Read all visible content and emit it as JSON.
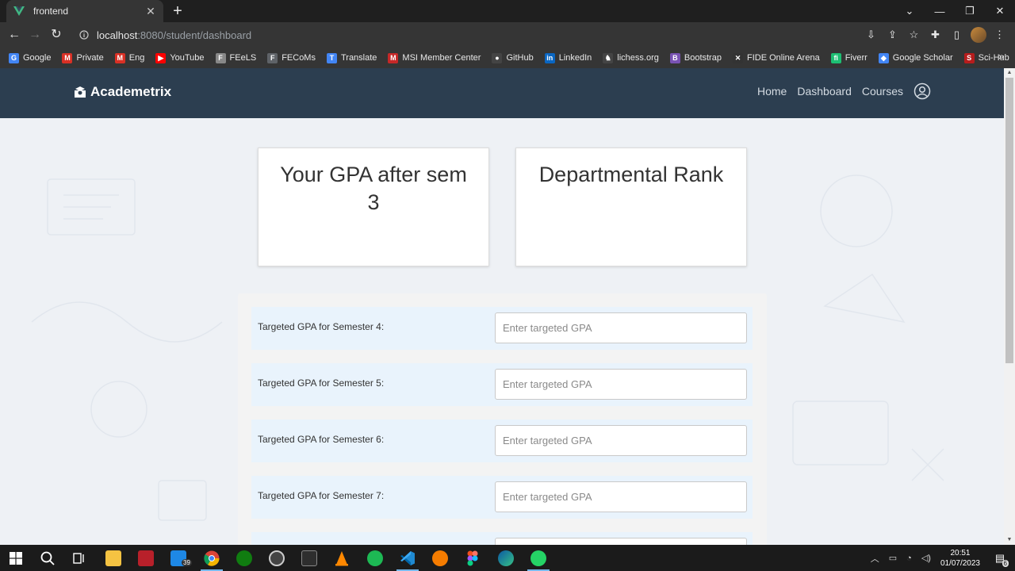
{
  "browser": {
    "tab_title": "frontend",
    "url_host": "localhost",
    "url_rest": ":8080/student/dashboard",
    "bookmarks": [
      {
        "label": "Google",
        "color": "#4285f4",
        "glyph": "G"
      },
      {
        "label": "Private",
        "color": "#d93025",
        "glyph": "M"
      },
      {
        "label": "Eng",
        "color": "#d93025",
        "glyph": "M"
      },
      {
        "label": "YouTube",
        "color": "#ff0000",
        "glyph": "▶"
      },
      {
        "label": "FEeLS",
        "color": "#888888",
        "glyph": "F"
      },
      {
        "label": "FECoMs",
        "color": "#5f6368",
        "glyph": "F"
      },
      {
        "label": "Translate",
        "color": "#4285f4",
        "glyph": "T"
      },
      {
        "label": "MSI Member Center",
        "color": "#c62828",
        "glyph": "M"
      },
      {
        "label": "GitHub",
        "color": "#444444",
        "glyph": "●"
      },
      {
        "label": "LinkedIn",
        "color": "#0a66c2",
        "glyph": "in"
      },
      {
        "label": "lichess.org",
        "color": "#444444",
        "glyph": "♞"
      },
      {
        "label": "Bootstrap",
        "color": "#7952b3",
        "glyph": "B"
      },
      {
        "label": "FIDE Online Arena",
        "color": "#333333",
        "glyph": "✕"
      },
      {
        "label": "Fiverr",
        "color": "#1dbf73",
        "glyph": "fi"
      },
      {
        "label": "Google Scholar",
        "color": "#4285f4",
        "glyph": "◆"
      },
      {
        "label": "Sci-Hub",
        "color": "#b71c1c",
        "glyph": "S"
      }
    ],
    "bookmarks_more": "»"
  },
  "app": {
    "brand": "Academetrix",
    "nav": {
      "home": "Home",
      "dashboard": "Dashboard",
      "courses": "Courses"
    }
  },
  "cards": {
    "gpa_title": "Your GPA after sem 3",
    "rank_title": "Departmental Rank"
  },
  "form": {
    "rows": [
      {
        "label": "Targeted GPA for Semester 4:",
        "placeholder": "Enter targeted GPA"
      },
      {
        "label": "Targeted GPA for Semester 5:",
        "placeholder": "Enter targeted GPA"
      },
      {
        "label": "Targeted GPA for Semester 6:",
        "placeholder": "Enter targeted GPA"
      },
      {
        "label": "Targeted GPA for Semester 7:",
        "placeholder": "Enter targeted GPA"
      }
    ]
  },
  "taskbar": {
    "badge_count": "39",
    "time": "20:51",
    "date": "01/07/2023",
    "notifications": "6"
  },
  "colors": {
    "navbar": "#2c3e50",
    "row_bg": "#e9f3fc"
  }
}
